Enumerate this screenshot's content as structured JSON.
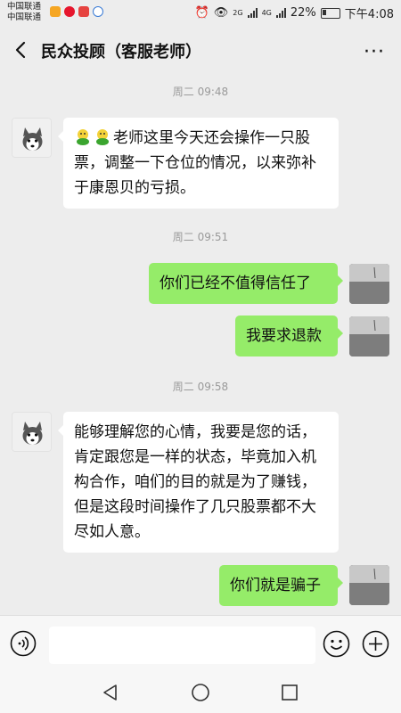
{
  "status_bar": {
    "carrier_1": "中国联通",
    "carrier_2": "中国联通",
    "network_1": "2G",
    "network_2": "4G",
    "battery": "22%",
    "time": "下午4:08"
  },
  "header": {
    "title": "民众投顾（客服老师）",
    "more_label": "···"
  },
  "messages": [
    {
      "type": "time",
      "text": "周二 09:48"
    },
    {
      "type": "incoming",
      "emoji": [
        "face-icon",
        "face-icon"
      ],
      "text": "老师这里今天还会操作一只股票，调整一下仓位的情况，以来弥补于康恩贝的亏损。"
    },
    {
      "type": "time",
      "text": "周二 09:51"
    },
    {
      "type": "outgoing",
      "text": "你们已经不值得信任了"
    },
    {
      "type": "outgoing",
      "text": "我要求退款"
    },
    {
      "type": "time",
      "text": "周二 09:58"
    },
    {
      "type": "incoming",
      "text": "能够理解您的心情，我要是您的话，肯定跟您是一样的状态，毕竟加入机构合作，咱们的目的就是为了赚钱，但是这段时间操作了几只股票都不大尽如人意。"
    },
    {
      "type": "outgoing",
      "text": "你们就是骗子"
    }
  ],
  "input": {
    "value": "",
    "placeholder": ""
  },
  "colors": {
    "outgoing_bubble": "#95ec69",
    "incoming_bubble": "#ffffff",
    "background": "#ededed"
  }
}
